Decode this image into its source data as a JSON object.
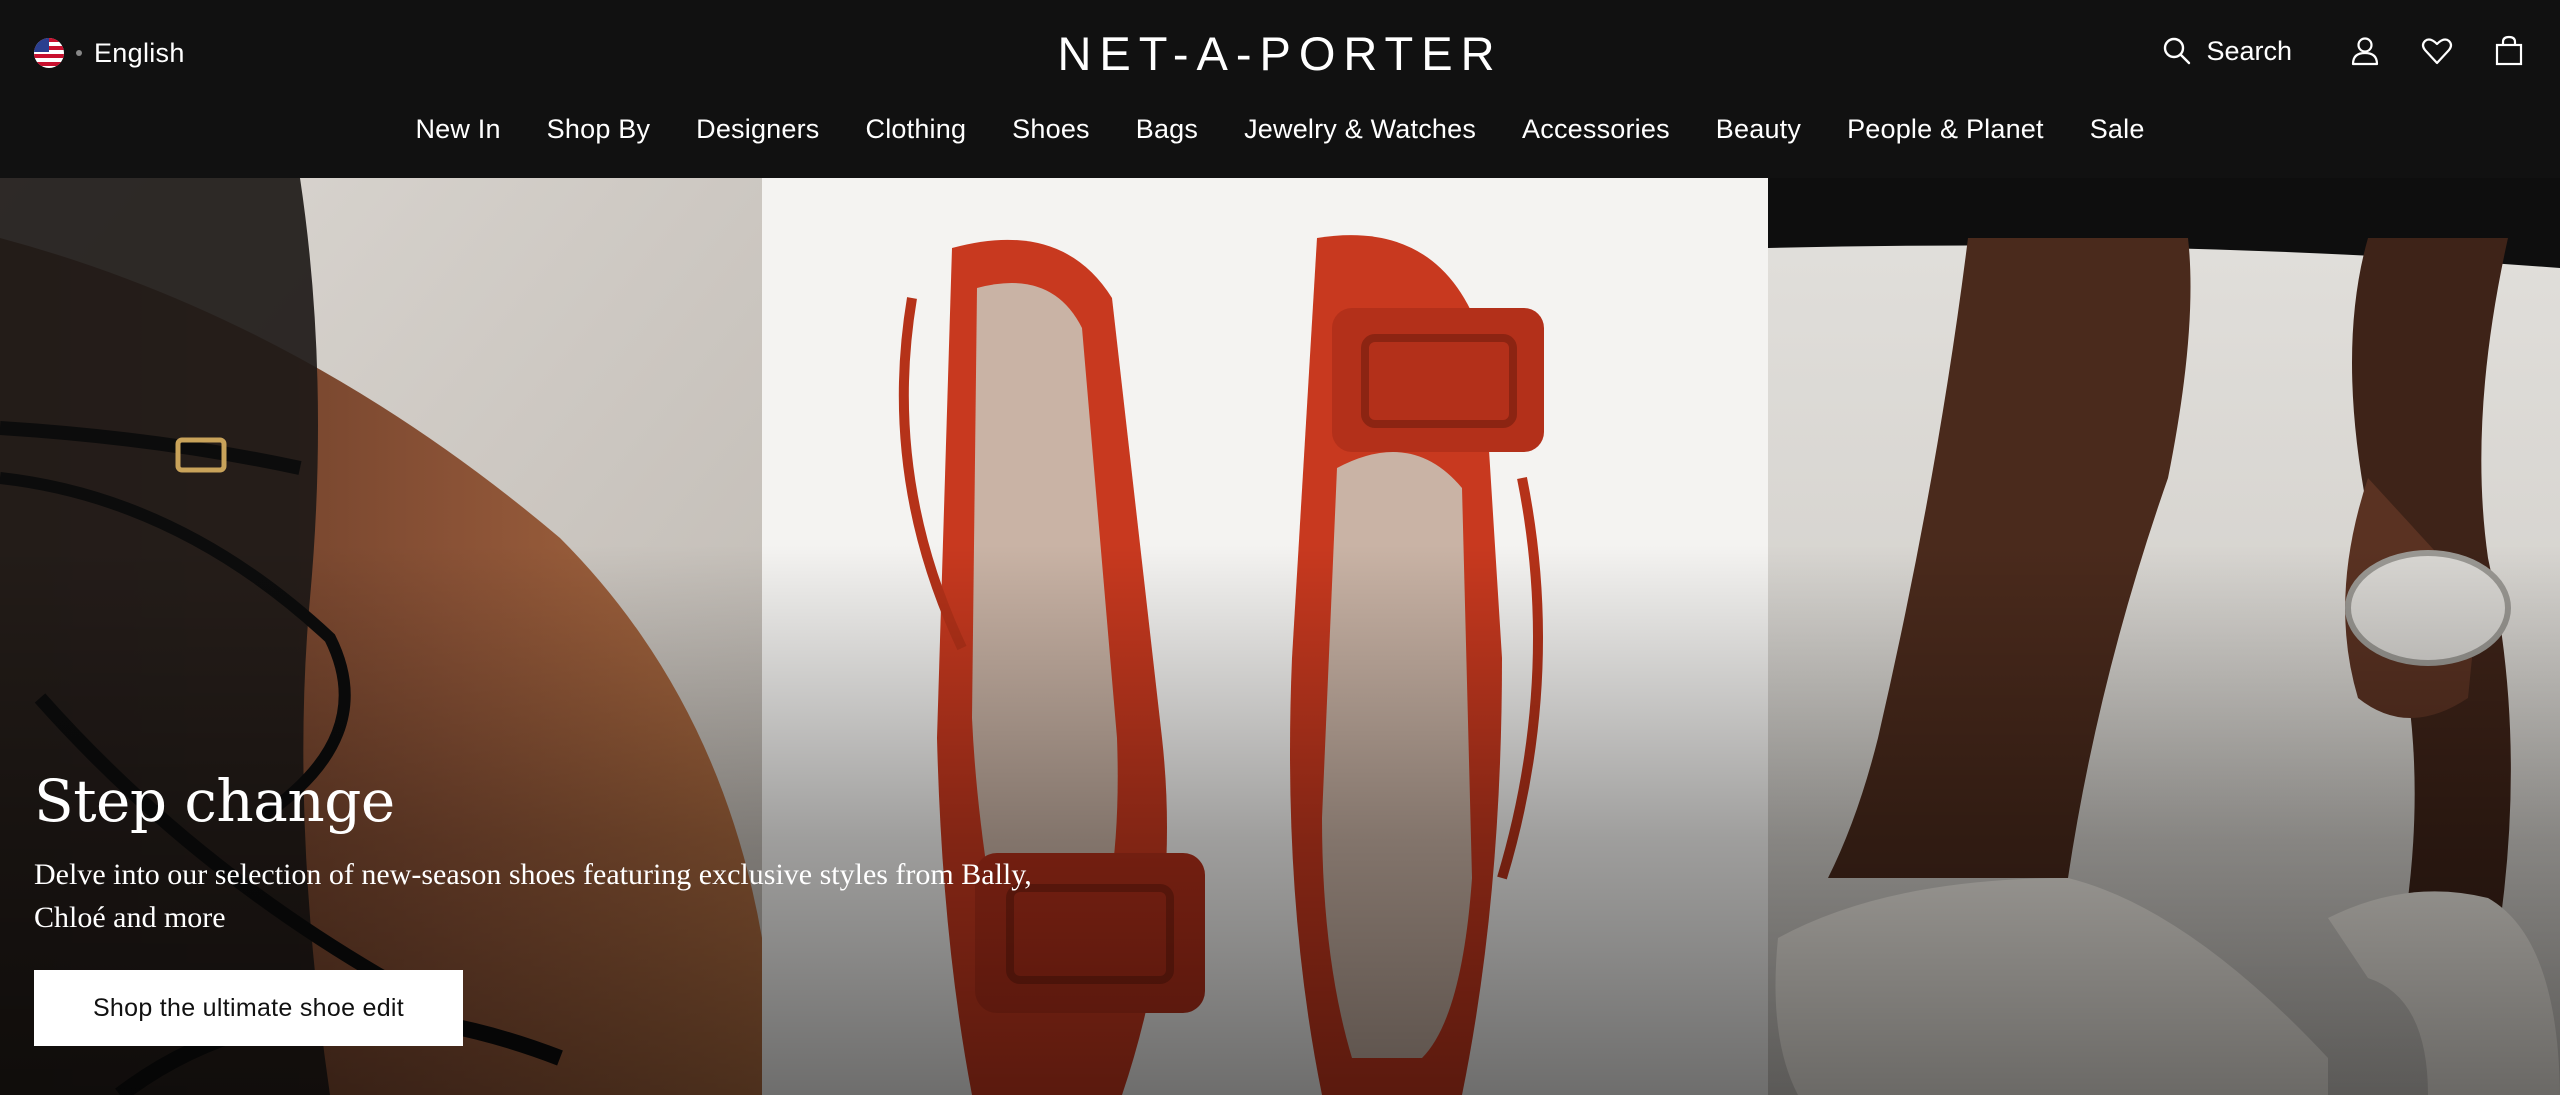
{
  "header": {
    "language": "English",
    "logo": "NET-A-PORTER",
    "search_label": "Search"
  },
  "nav": {
    "items": [
      "New In",
      "Shop By",
      "Designers",
      "Clothing",
      "Shoes",
      "Bags",
      "Jewelry & Watches",
      "Accessories",
      "Beauty",
      "People & Planet",
      "Sale"
    ]
  },
  "hero": {
    "title": "Step change",
    "description": "Delve into our selection of new-season shoes featuring exclusive styles from Bally, Chloé and more",
    "cta": "Shop the ultimate shoe edit"
  },
  "colors": {
    "header_bg": "#111111",
    "text": "#ffffff",
    "shoe_red": "#c8391f",
    "cta_bg": "#ffffff"
  }
}
